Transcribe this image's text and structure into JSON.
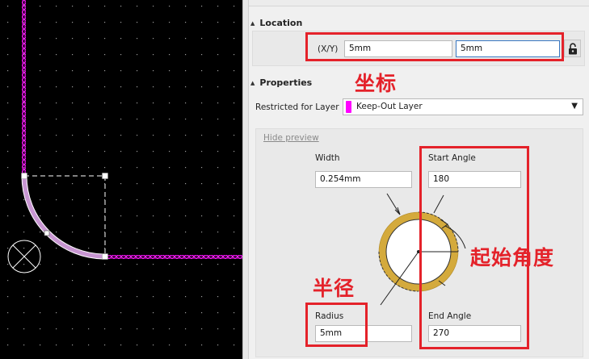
{
  "canvas": {
    "board_color": "#000000",
    "keepout_color": "#ff00ff",
    "arc_color": "#c896d2"
  },
  "location": {
    "header": "Location",
    "xy_label": "(X/Y)",
    "x_value": "5mm",
    "y_value": "5mm",
    "lock_icon": "unlocked-padlock-icon"
  },
  "properties": {
    "header": "Properties",
    "layer_label": "Restricted for Layer",
    "layer_value": "Keep-Out Layer",
    "layer_color": "#ff00ff",
    "hide_preview": "Hide preview",
    "width_label": "Width",
    "width_value": "0.254mm",
    "start_angle_label": "Start Angle",
    "start_angle_value": "180",
    "radius_label": "Radius",
    "radius_value": "5mm",
    "end_angle_label": "End Angle",
    "end_angle_value": "270",
    "ring_color": "#d4aa3c"
  },
  "annotations": {
    "coordinate": "坐标",
    "radius": "半径",
    "start_angle": "起始角度",
    "color": "#e4222a"
  }
}
